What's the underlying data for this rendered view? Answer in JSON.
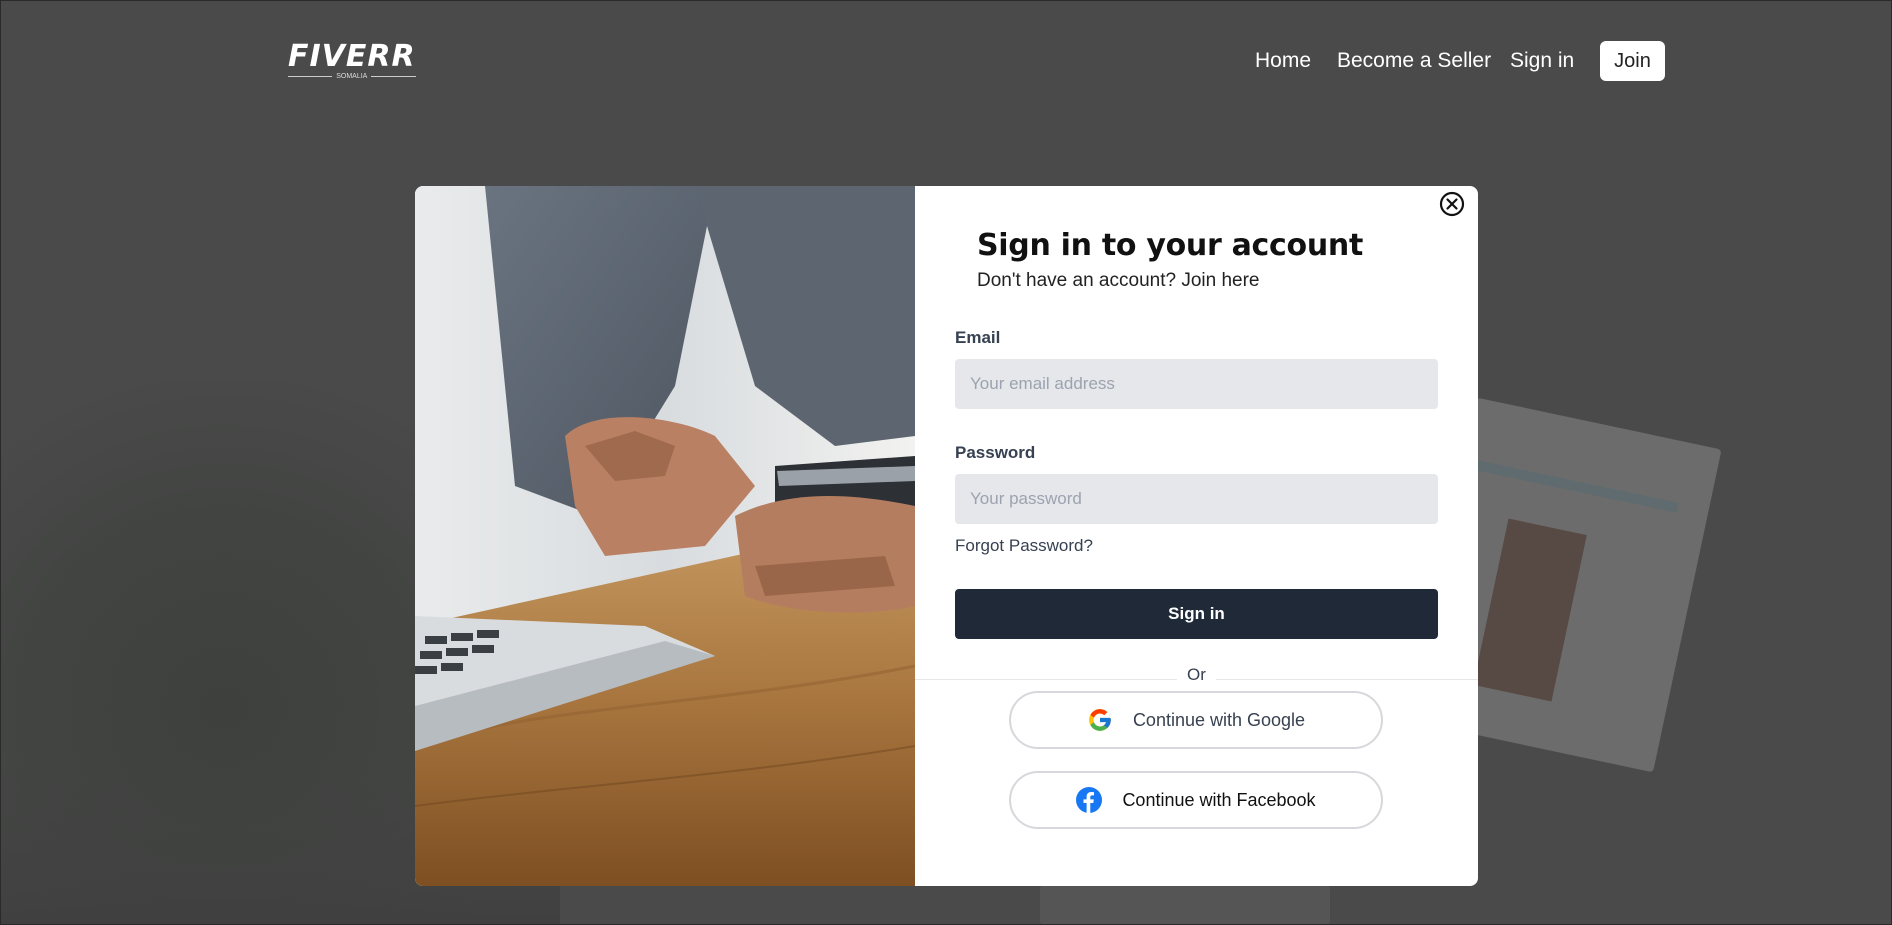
{
  "header": {
    "logo_text": "FIVERR",
    "logo_subtext": "SOMALIA",
    "nav": {
      "home": "Home",
      "become_seller": "Become a Seller",
      "sign_in": "Sign in",
      "join": "Join"
    }
  },
  "modal": {
    "title": "Sign in to your account",
    "subtitle": "Don't have an account? Join here",
    "email": {
      "label": "Email",
      "placeholder": "Your email address",
      "value": ""
    },
    "password": {
      "label": "Password",
      "placeholder": "Your password",
      "value": ""
    },
    "forgot_label": "Forgot Password?",
    "signin_label": "Sign in",
    "divider_label": "Or",
    "google_label": "Continue with Google",
    "facebook_label": "Continue with Facebook",
    "icons": {
      "close": "close-icon",
      "google": "google-icon",
      "facebook": "facebook-icon"
    }
  },
  "colors": {
    "overlay": "#4a4a4a",
    "primary_button": "#1f2937",
    "input_bg": "#e5e7eb",
    "facebook_blue": "#1877f2"
  }
}
